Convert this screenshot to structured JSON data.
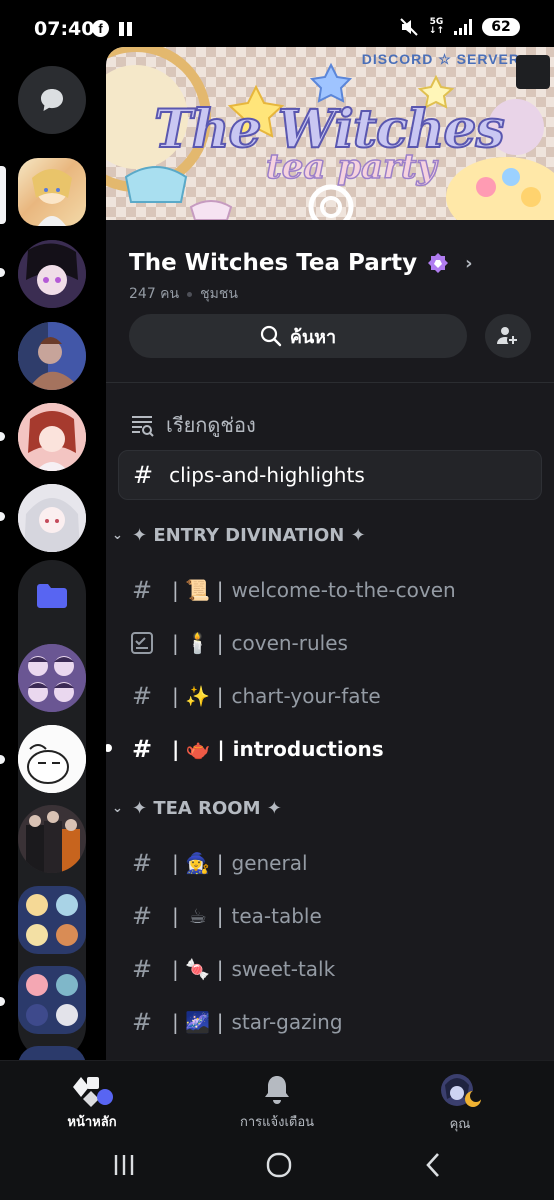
{
  "status_bar": {
    "time": "07:40",
    "network": "5G",
    "battery": "62",
    "icons": [
      "facebook-icon",
      "pause-icon",
      "mute-icon",
      "signal-icon",
      "battery-icon"
    ]
  },
  "rail": {
    "dm_icon": "chat-bubble-icon",
    "folder_icon": "folder-icon"
  },
  "banner": {
    "tag": "DISCORD ☆ SERVER",
    "title": "The Witches",
    "subtitle": "tea party"
  },
  "server": {
    "name": "The Witches Tea Party",
    "members": "247 คน",
    "type": "ชุมชน",
    "search_label": "ค้นหา"
  },
  "browse_label": "เรียกดูช่อง",
  "pinned_channel": "clips-and-highlights",
  "categories": [
    {
      "name": "✦ ENTRY DIVINATION ✦",
      "channels": [
        {
          "icon": "#",
          "emoji": "📜",
          "name": "welcome-to-the-coven"
        },
        {
          "icon": "rules",
          "emoji": "🕯️",
          "name": "coven-rules"
        },
        {
          "icon": "#",
          "emoji": "✨",
          "name": "chart-your-fate"
        },
        {
          "icon": "#",
          "emoji": "🫖",
          "name": "introductions"
        }
      ]
    },
    {
      "name": "✦ TEA ROOM ✦",
      "channels": [
        {
          "icon": "#",
          "emoji": "🧙‍♀️",
          "name": "general"
        },
        {
          "icon": "#",
          "emoji": "☕",
          "name": "tea-table"
        },
        {
          "icon": "#",
          "emoji": "🍬",
          "name": "sweet-talk"
        },
        {
          "icon": "#",
          "emoji": "🌌",
          "name": "star-gazing"
        }
      ]
    }
  ],
  "separator": "|",
  "nav": {
    "home": "หน้าหลัก",
    "notifications": "การแจ้งเตือน",
    "you": "คุณ"
  },
  "colors": {
    "background": "#1a1a1e",
    "rail": "#000000",
    "accent": "#5865f2",
    "boost": "#b07cf0"
  }
}
